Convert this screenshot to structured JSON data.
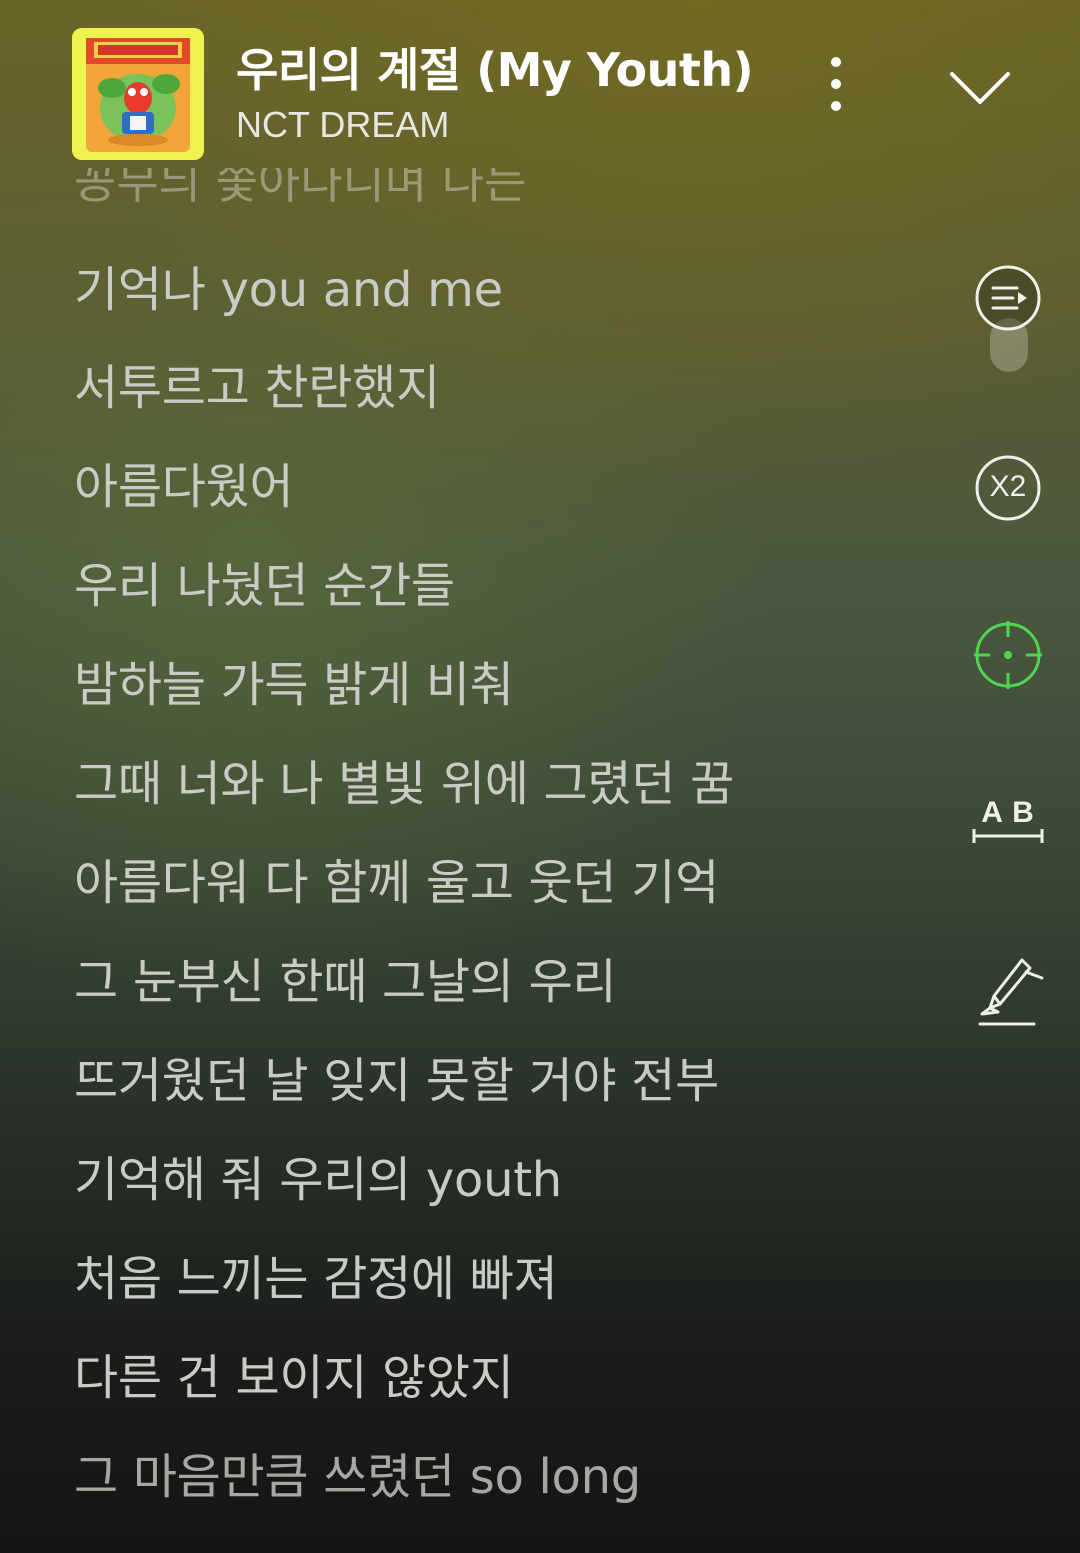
{
  "header": {
    "album_art_icon": "album-cover-image",
    "title": "우리의 계절 (My Youth)",
    "artist": "NCT DREAM",
    "more_icon": "more-vertical-icon",
    "collapse_icon": "chevron-down-icon"
  },
  "lyrics": {
    "partial_top": "꽁무늬 쫓아다니며 나는",
    "lines": [
      "기억나 you and me",
      "서투르고 찬란했지",
      "아름다웠어",
      "우리 나눴던 순간들",
      "밤하늘 가득 밝게 비춰",
      "그때 너와 나 별빛 위에 그렸던 꿈",
      "아름다워 다 함께 울고 웃던 기억",
      "그 눈부신 한때 그날의 우리",
      "뜨거웠던 날 잊지 못할 거야 전부",
      "기억해 줘 우리의 youth",
      "처음 느끼는 감정에 빠져",
      "다른 건 보이지 않았지",
      "그 마음만큼 쓰렸던 so long"
    ]
  },
  "side_tools": {
    "playlist_icon": "playlist-play-icon",
    "speed_label": "X2",
    "locate_icon": "crosshair-icon",
    "translate_label": "A B",
    "highlight_icon": "highlighter-icon",
    "accent_color": "#4fd64f"
  }
}
